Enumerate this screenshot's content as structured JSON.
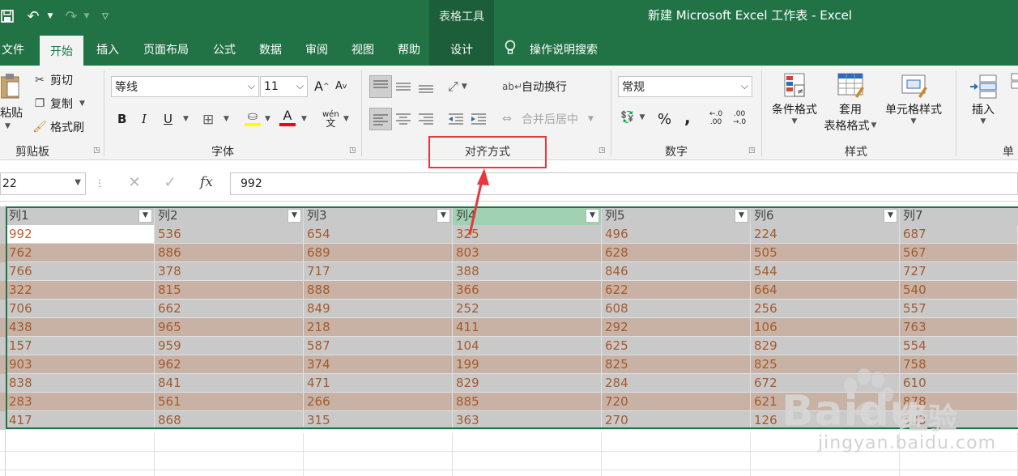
{
  "titlebar": {
    "context_tools": "表格工具",
    "doc_title": "新建 Microsoft Excel 工作表  -  Excel"
  },
  "tabs": [
    {
      "label": "文件"
    },
    {
      "label": "开始"
    },
    {
      "label": "插入"
    },
    {
      "label": "页面布局"
    },
    {
      "label": "公式"
    },
    {
      "label": "数据"
    },
    {
      "label": "审阅"
    },
    {
      "label": "视图"
    },
    {
      "label": "帮助"
    },
    {
      "label": "设计"
    }
  ],
  "tell_me": "操作说明搜索",
  "ribbon": {
    "clipboard": {
      "paste": "粘贴",
      "cut": "剪切",
      "copy": "复制",
      "format_painter": "格式刷",
      "label": "剪贴板"
    },
    "font": {
      "font_name": "等线",
      "font_size": "11",
      "grow": "A",
      "shrink": "A",
      "bold": "B",
      "italic": "I",
      "underline": "U",
      "wen": "wén",
      "font_color": "A",
      "label": "字体"
    },
    "alignment": {
      "wrap_text": "自动换行",
      "merge_center": "合并后居中",
      "label": "对齐方式"
    },
    "number": {
      "format": "常规",
      "percent": "%",
      "comma": ",",
      "inc_decimal": "←.0\n.00",
      "dec_decimal": ".00\n→.0",
      "label": "数字"
    },
    "styles": {
      "conditional": "条件格式",
      "table_format_1": "套用",
      "table_format_2": "表格格式",
      "cell_styles": "单元格样式",
      "label": "样式"
    },
    "cells": {
      "insert": "插入",
      "label": "单"
    }
  },
  "formula_bar": {
    "name_box": "22",
    "fx": "fx",
    "value": "992"
  },
  "table": {
    "headers": [
      "列1",
      "列2",
      "列3",
      "列4",
      "列5",
      "列6",
      "列7"
    ],
    "rows": [
      [
        "992",
        "536",
        "654",
        "325",
        "496",
        "224",
        "687"
      ],
      [
        "762",
        "886",
        "689",
        "803",
        "628",
        "505",
        "567"
      ],
      [
        "766",
        "378",
        "717",
        "388",
        "846",
        "544",
        "727"
      ],
      [
        "322",
        "815",
        "888",
        "366",
        "622",
        "664",
        "540"
      ],
      [
        "706",
        "662",
        "849",
        "252",
        "608",
        "256",
        "557"
      ],
      [
        "438",
        "965",
        "218",
        "411",
        "292",
        "106",
        "763"
      ],
      [
        "157",
        "959",
        "587",
        "104",
        "625",
        "829",
        "554"
      ],
      [
        "903",
        "962",
        "374",
        "199",
        "825",
        "825",
        "758"
      ],
      [
        "838",
        "841",
        "471",
        "829",
        "284",
        "672",
        "610"
      ],
      [
        "283",
        "561",
        "266",
        "885",
        "720",
        "621",
        "878"
      ],
      [
        "417",
        "868",
        "315",
        "363",
        "270",
        "126",
        "583"
      ]
    ]
  },
  "watermark": {
    "brand": "Baidu",
    "cn": "经验",
    "url": "jingyan.baidu.com"
  },
  "colors": {
    "excel_green": "#217346",
    "annotation_red": "#e8363c",
    "band_gray": "#c9c9c9",
    "band_brown": "#c8b2a6",
    "cell_text": "#a45a2c"
  }
}
